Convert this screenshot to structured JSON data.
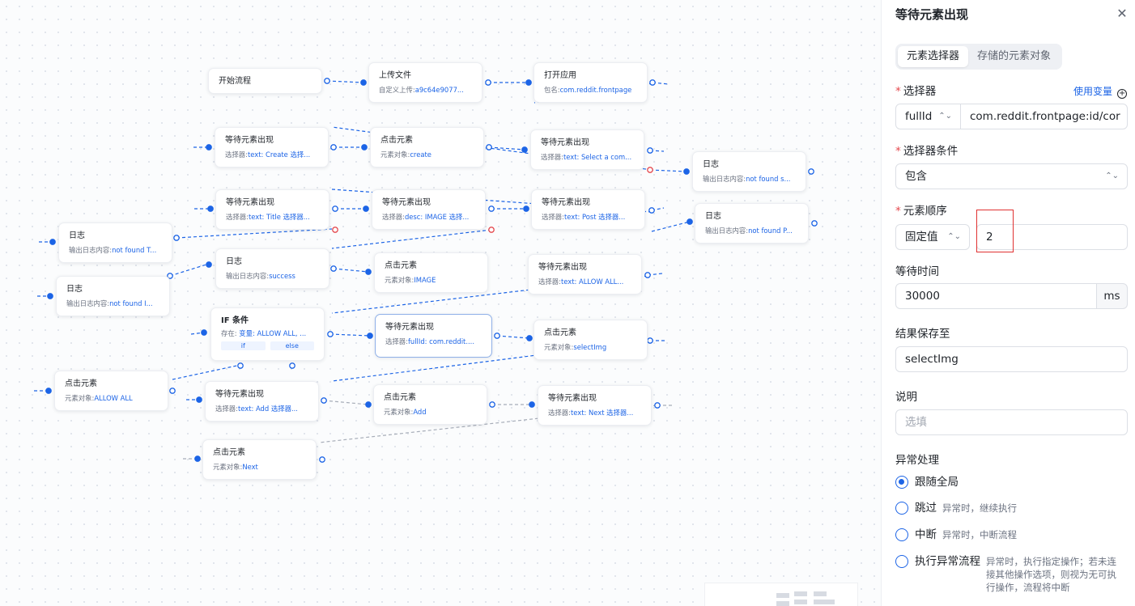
{
  "canvas": {
    "nodes": [
      {
        "title": "开始流程"
      },
      {
        "title": "上传文件",
        "label": "自定义上传:",
        "value": "a9c64e9077..."
      },
      {
        "title": "打开应用",
        "label": "包名:",
        "value": "com.reddit.frontpage"
      },
      {
        "title": "等待元素出现",
        "label": "选择器:",
        "value": "text: Create 选择..."
      },
      {
        "title": "点击元素",
        "label": "元素对象:",
        "value": "create"
      },
      {
        "title": "等待元素出现",
        "label": "选择器:",
        "value": "text: Select a com..."
      },
      {
        "title": "日志",
        "label": "输出日志内容:",
        "value": "not found s..."
      },
      {
        "title": "等待元素出现",
        "label": "选择器:",
        "value": "text: Title 选择器..."
      },
      {
        "title": "等待元素出现",
        "label": "选择器:",
        "value": "desc: IMAGE 选择..."
      },
      {
        "title": "等待元素出现",
        "label": "选择器:",
        "value": "text: Post 选择器..."
      },
      {
        "title": "日志",
        "label": "输出日志内容:",
        "value": "not found P..."
      },
      {
        "title": "日志",
        "label": "输出日志内容:",
        "value": "not found T..."
      },
      {
        "title": "日志",
        "label": "输出日志内容:",
        "value": "success"
      },
      {
        "title": "点击元素",
        "label": "元素对象:",
        "value": "IMAGE"
      },
      {
        "title": "等待元素出现",
        "label": "选择器:",
        "value": "text: ALLOW ALL..."
      },
      {
        "title": "日志",
        "label": "输出日志内容:",
        "value": "not found I..."
      },
      {
        "title": "IF 条件",
        "label": "存在:",
        "value": "变量: ALLOW ALL, ...",
        "branches": [
          "if",
          "else"
        ]
      },
      {
        "title": "等待元素出现",
        "label": "选择器:",
        "value": "fullId: com.reddit...."
      },
      {
        "title": "点击元素",
        "label": "元素对象:",
        "value": "selectImg"
      },
      {
        "title": "点击元素",
        "label": "元素对象:",
        "value": "ALLOW ALL"
      },
      {
        "title": "等待元素出现",
        "label": "选择器:",
        "value": "text: Add 选择器..."
      },
      {
        "title": "点击元素",
        "label": "元素对象:",
        "value": "Add"
      },
      {
        "title": "等待元素出现",
        "label": "选择器:",
        "value": "text: Next 选择器..."
      },
      {
        "title": "点击元素",
        "label": "元素对象:",
        "value": "Next"
      }
    ]
  },
  "panel": {
    "title": "等待元素出现",
    "close_icon": "close-icon",
    "tabs": [
      {
        "label": "元素选择器",
        "active": true
      },
      {
        "label": "存储的元素对象",
        "active": false
      }
    ],
    "selector": {
      "label": "选择器",
      "use_variable": "使用变量",
      "type": "fullId",
      "value": "com.reddit.frontpage:id/cor"
    },
    "condition": {
      "label": "选择器条件",
      "value": "包含"
    },
    "order": {
      "label": "元素顺序",
      "mode": "固定值",
      "value": "2"
    },
    "wait": {
      "label": "等待时间",
      "value": "30000",
      "unit": "ms"
    },
    "result": {
      "label": "结果保存至",
      "value": "selectImg"
    },
    "note": {
      "label": "说明",
      "placeholder": "选填"
    },
    "exception": {
      "label": "异常处理",
      "options": [
        {
          "name": "跟随全局",
          "desc": "",
          "selected": true
        },
        {
          "name": "跳过",
          "desc": "异常时，继续执行",
          "selected": false
        },
        {
          "name": "中断",
          "desc": "异常时，中断流程",
          "selected": false
        },
        {
          "name": "执行异常流程",
          "desc": "异常时，执行指定操作；若未连接其他操作选项，则视为无可执行操作，流程将中断",
          "selected": false
        }
      ]
    },
    "colors": {
      "accent": "#1c64e6",
      "required": "#e5484d",
      "highlight": "#e03131"
    }
  }
}
